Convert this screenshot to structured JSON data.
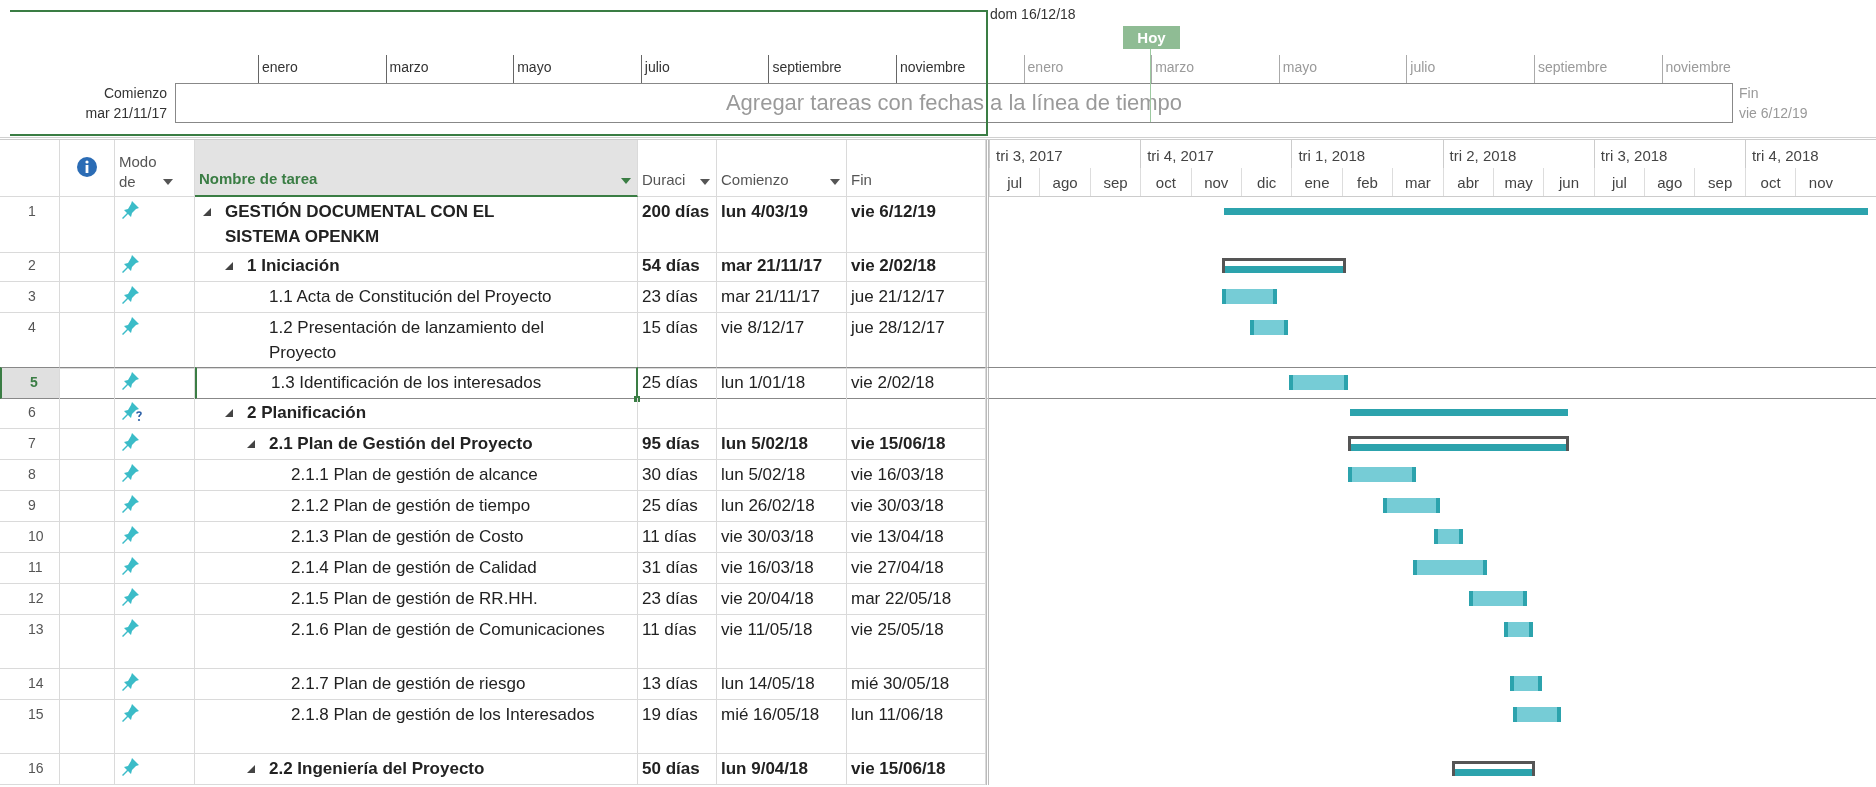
{
  "timeline": {
    "date_marker": "dom 16/12/18",
    "today_label": "Hoy",
    "start_label": "Comienzo",
    "start_date": "mar 21/11/17",
    "hint": "Agregar tareas con fechas a la línea de tiempo",
    "end_label": "Fin",
    "end_date": "vie 6/12/19",
    "months": [
      {
        "label": "enero",
        "in_view": true
      },
      {
        "label": "marzo",
        "in_view": true
      },
      {
        "label": "mayo",
        "in_view": true
      },
      {
        "label": "julio",
        "in_view": true
      },
      {
        "label": "septiembre",
        "in_view": true
      },
      {
        "label": "noviembre",
        "in_view": true
      },
      {
        "label": "enero",
        "in_view": false
      },
      {
        "label": "marzo",
        "in_view": false
      },
      {
        "label": "mayo",
        "in_view": false
      },
      {
        "label": "julio",
        "in_view": false
      },
      {
        "label": "septiembre",
        "in_view": false
      },
      {
        "label": "noviembre",
        "in_view": false
      }
    ]
  },
  "table": {
    "columns": [
      {
        "kind": "info"
      },
      {
        "kind": "text",
        "label": "Modo de",
        "dropdown": true,
        "selected": false
      },
      {
        "kind": "text",
        "label": "Nombre de tarea",
        "dropdown": true,
        "selected": true
      },
      {
        "kind": "text",
        "label": "Duraci",
        "dropdown": true,
        "selected": false
      },
      {
        "kind": "text",
        "label": "Comienzo",
        "dropdown": true,
        "selected": false
      },
      {
        "kind": "text",
        "label": "Fin",
        "dropdown": false,
        "selected": false
      }
    ],
    "tasks": [
      {
        "kind": "project",
        "number": "1",
        "name": "GESTIÓN DOCUMENTAL CON EL SISTEMA OPENKM",
        "duration": "200 días",
        "start": "lun 4/03/19",
        "finish": "vie 6/12/19",
        "expanded": true,
        "selected": false,
        "children": [
          {
            "kind": "summary",
            "number": "2",
            "name": "1 Iniciación",
            "duration": "54 días",
            "start": "mar 21/11/17",
            "finish": "vie 2/02/18",
            "expanded": true,
            "selected": false,
            "children": [
              {
                "kind": "task",
                "number": "3",
                "name": "1.1 Acta de Constitución del Proyecto",
                "duration": "23 días",
                "start": "mar 21/11/17",
                "finish": "jue 21/12/17",
                "selected": false
              },
              {
                "kind": "task",
                "number": "4",
                "name": "1.2 Presentación de lanzamiento del Proyecto",
                "duration": "15 días",
                "start": "vie 8/12/17",
                "finish": "jue 28/12/17",
                "selected": false
              },
              {
                "kind": "task",
                "number": "5",
                "name": "1.3 Identificación de los interesados",
                "duration": "25 días",
                "start": "lun 1/01/18",
                "finish": "vie 2/02/18",
                "selected": true
              }
            ]
          },
          {
            "kind": "manual_summary",
            "number": "6",
            "name": "2 Planificación",
            "expanded": true,
            "selected": false,
            "children": [
              {
                "kind": "summary",
                "number": "7",
                "name": "2.1 Plan de Gestión del Proyecto",
                "duration": "95 días",
                "start": "lun 5/02/18",
                "finish": "vie 15/06/18",
                "expanded": true,
                "selected": false,
                "children": [
                  {
                    "kind": "task",
                    "number": "8",
                    "name": "2.1.1 Plan de gestión de alcance",
                    "duration": "30 días",
                    "start": "lun 5/02/18",
                    "finish": "vie 16/03/18",
                    "selected": false
                  },
                  {
                    "kind": "task",
                    "number": "9",
                    "name": "2.1.2 Plan de gestión de tiempo",
                    "duration": "25 días",
                    "start": "lun 26/02/18",
                    "finish": "vie 30/03/18",
                    "selected": false
                  },
                  {
                    "kind": "task",
                    "number": "10",
                    "name": "2.1.3 Plan de gestión de Costo",
                    "duration": "11 días",
                    "start": "vie 30/03/18",
                    "finish": "vie 13/04/18",
                    "selected": false
                  },
                  {
                    "kind": "task",
                    "number": "11",
                    "name": "2.1.4 Plan de gestión de Calidad",
                    "duration": "31 días",
                    "start": "vie 16/03/18",
                    "finish": "vie 27/04/18",
                    "selected": false
                  },
                  {
                    "kind": "task",
                    "number": "12",
                    "name": "2.1.5 Plan de gestión de RR.HH.",
                    "duration": "23 días",
                    "start": "vie 20/04/18",
                    "finish": "mar 22/05/18",
                    "selected": false
                  },
                  {
                    "kind": "task",
                    "number": "13",
                    "name": "2.1.6 Plan de gestión de Comunicaciones",
                    "duration": "11 días",
                    "start": "vie 11/05/18",
                    "finish": "vie 25/05/18",
                    "selected": false
                  },
                  {
                    "kind": "task",
                    "number": "14",
                    "name": "2.1.7 Plan de gestión de riesgo",
                    "duration": "13 días",
                    "start": "lun 14/05/18",
                    "finish": "mié 30/05/18",
                    "selected": false
                  },
                  {
                    "kind": "task",
                    "number": "15",
                    "name": "2.1.8 Plan de gestión de los Interesados",
                    "duration": "19 días",
                    "start": "mié 16/05/18",
                    "finish": "lun 11/06/18",
                    "selected": false
                  }
                ]
              },
              {
                "kind": "summary",
                "number": "16",
                "name": "2.2 Ingeniería del Proyecto",
                "duration": "50 días",
                "start": "lun 9/04/18",
                "finish": "vie 15/06/18",
                "expanded": true,
                "selected": false
              }
            ]
          }
        ]
      }
    ]
  },
  "gantt": {
    "quarters": [
      "tri 3, 2017",
      "tri 4, 2017",
      "tri 1, 2018",
      "tri 2, 2018",
      "tri 3, 2018",
      "tri 4, 2018"
    ],
    "months": [
      "jul",
      "ago",
      "sep",
      "oct",
      "nov",
      "dic",
      "ene",
      "feb",
      "mar",
      "abr",
      "may",
      "jun",
      "jul",
      "ago",
      "sep",
      "oct",
      "nov"
    ]
  }
}
